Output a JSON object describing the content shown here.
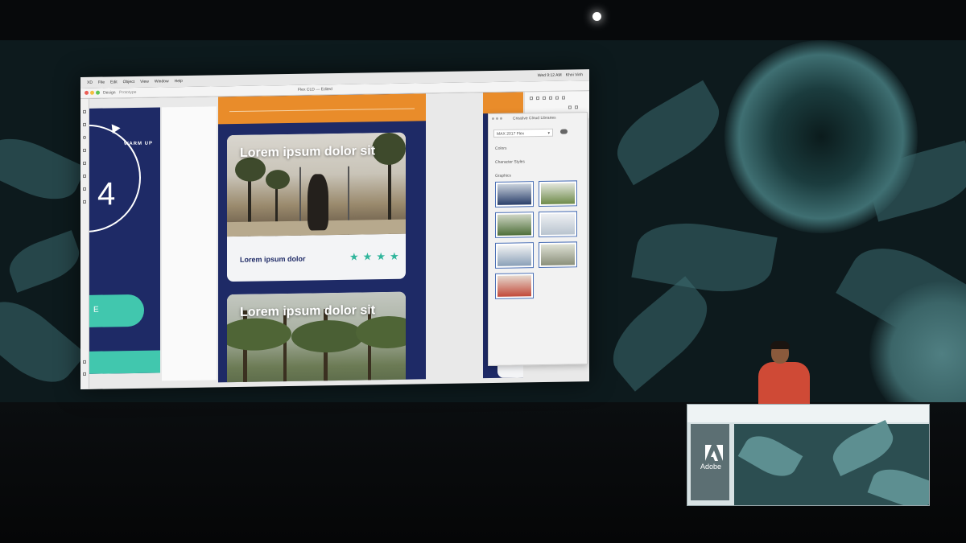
{
  "menubar": {
    "items": [
      "XD",
      "File",
      "Edit",
      "Object",
      "View",
      "Window",
      "Help"
    ],
    "status": [
      "Wed 9:12 AM",
      "Khoi Vinh"
    ]
  },
  "window": {
    "tabs": [
      "Design",
      "Prototype"
    ],
    "document_title": "Flex CLD — Edited"
  },
  "artboard_left": {
    "number": "4",
    "label": "WARM UP",
    "button_text": "E"
  },
  "cards": [
    {
      "title": "Lorem ipsum dolor sit",
      "caption": "Lorem ipsum dolor",
      "rating": 4
    },
    {
      "title": "Lorem ipsum dolor sit"
    }
  ],
  "star_glyph": "★",
  "libraries_panel": {
    "title": "Creative Cloud Libraries",
    "library_select": "MAX 2017 Flex",
    "chevron": "▾",
    "sections": [
      "Colors",
      "Character Styles",
      "Graphics"
    ],
    "thumbnail_colors": [
      "#2a3f6a",
      "#6f8b4a",
      "#4f6f3a",
      "#b9c4cf",
      "#d9d9d9",
      "#8a8f7a",
      "#c24a3a"
    ]
  },
  "podium": {
    "brand": "Adobe"
  },
  "colors": {
    "navy": "#1e2a66",
    "orange": "#e98c2a",
    "teal": "#41c7ae"
  }
}
